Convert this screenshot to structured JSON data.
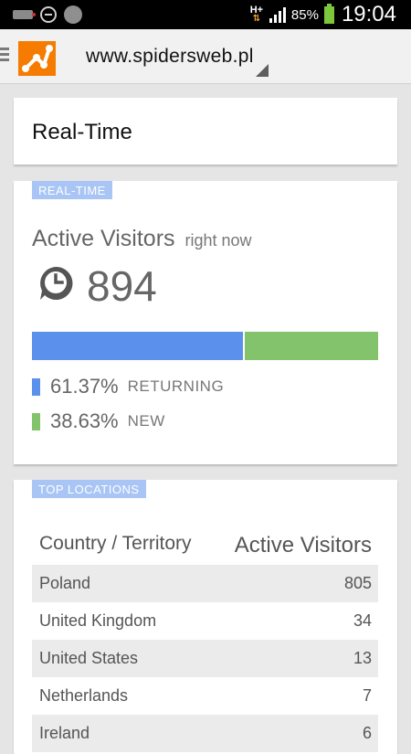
{
  "status_bar": {
    "battery": "85%",
    "time": "19:04",
    "network": "H+"
  },
  "action_bar": {
    "account": "www.spidersweb.pl"
  },
  "page": {
    "title": "Real-Time"
  },
  "realtime_card": {
    "badge": "REAL-TIME",
    "title": "Active Visitors",
    "subtitle": "right now",
    "count": "894",
    "returning": {
      "percent": "61.37%",
      "label": "RETURNING",
      "fraction": 0.6137,
      "color": "#5b91ec"
    },
    "new": {
      "percent": "38.63%",
      "label": "NEW",
      "fraction": 0.3863,
      "color": "#83c36c"
    }
  },
  "locations_card": {
    "badge": "TOP LOCATIONS",
    "col_country": "Country / Territory",
    "col_visitors": "Active Visitors",
    "rows": [
      {
        "country": "Poland",
        "visitors": "805"
      },
      {
        "country": "United Kingdom",
        "visitors": "34"
      },
      {
        "country": "United States",
        "visitors": "13"
      },
      {
        "country": "Netherlands",
        "visitors": "7"
      },
      {
        "country": "Ireland",
        "visitors": "6"
      }
    ]
  },
  "colors": {
    "brand": "#f57c00",
    "badge_bg": "#a9c5f5"
  },
  "icons": {
    "menu": "menu-icon",
    "logo": "analytics-logo-icon",
    "dropdown": "dropdown-triangle-icon",
    "clock": "clock-icon"
  }
}
